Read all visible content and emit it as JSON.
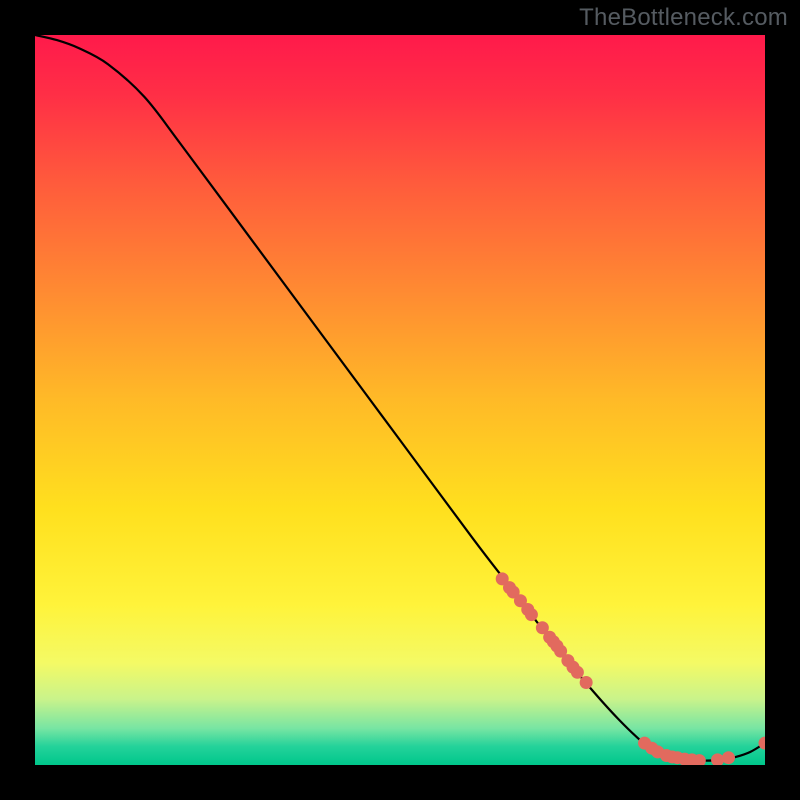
{
  "watermark": "TheBottleneck.com",
  "colors": {
    "bg_black": "#000000",
    "curve": "#000000",
    "dot_fill": "#e26a5e",
    "dot_stroke": "#c74a3e"
  },
  "chart_data": {
    "type": "line",
    "title": "",
    "xlabel": "",
    "ylabel": "",
    "xlim": [
      0,
      100
    ],
    "ylim": [
      0,
      100
    ],
    "grid": false,
    "legend": false,
    "series": [
      {
        "name": "curve",
        "x": [
          0,
          3,
          6,
          10,
          15,
          20,
          30,
          40,
          50,
          60,
          65,
          70,
          75,
          80,
          84,
          86,
          88,
          90,
          92,
          94,
          96,
          98,
          100
        ],
        "y": [
          100,
          99.3,
          98.2,
          96,
          91.5,
          85,
          71.5,
          58,
          44.5,
          31,
          24.5,
          18,
          11.8,
          6.2,
          2.5,
          1.6,
          1.0,
          0.7,
          0.6,
          0.7,
          1.1,
          1.8,
          3.0
        ]
      }
    ],
    "points": [
      {
        "name": "dot",
        "x": 64,
        "y": 25.5
      },
      {
        "name": "dot",
        "x": 65,
        "y": 24.3
      },
      {
        "name": "dot",
        "x": 65.5,
        "y": 23.7
      },
      {
        "name": "dot",
        "x": 66.5,
        "y": 22.5
      },
      {
        "name": "dot",
        "x": 67.5,
        "y": 21.3
      },
      {
        "name": "dot",
        "x": 68,
        "y": 20.6
      },
      {
        "name": "dot",
        "x": 69.5,
        "y": 18.8
      },
      {
        "name": "dot",
        "x": 70.5,
        "y": 17.5
      },
      {
        "name": "dot",
        "x": 71,
        "y": 16.9
      },
      {
        "name": "dot",
        "x": 71.5,
        "y": 16.3
      },
      {
        "name": "dot",
        "x": 72,
        "y": 15.6
      },
      {
        "name": "dot",
        "x": 73,
        "y": 14.3
      },
      {
        "name": "dot",
        "x": 73.7,
        "y": 13.4
      },
      {
        "name": "dot",
        "x": 74.3,
        "y": 12.7
      },
      {
        "name": "dot",
        "x": 75.5,
        "y": 11.3
      },
      {
        "name": "dot",
        "x": 83.5,
        "y": 3.0
      },
      {
        "name": "dot",
        "x": 84.5,
        "y": 2.3
      },
      {
        "name": "dot",
        "x": 85.3,
        "y": 1.8
      },
      {
        "name": "dot",
        "x": 86.5,
        "y": 1.3
      },
      {
        "name": "dot",
        "x": 87.3,
        "y": 1.1
      },
      {
        "name": "dot",
        "x": 88,
        "y": 1.0
      },
      {
        "name": "dot",
        "x": 89,
        "y": 0.8
      },
      {
        "name": "dot",
        "x": 90,
        "y": 0.7
      },
      {
        "name": "dot",
        "x": 91,
        "y": 0.6
      },
      {
        "name": "dot",
        "x": 93.5,
        "y": 0.7
      },
      {
        "name": "dot",
        "x": 95,
        "y": 1.0
      },
      {
        "name": "dot",
        "x": 100,
        "y": 3.0
      }
    ],
    "background_gradient_stops": [
      {
        "offset": 0.0,
        "color": "#ff1a4b"
      },
      {
        "offset": 0.08,
        "color": "#ff2e46"
      },
      {
        "offset": 0.2,
        "color": "#ff5a3c"
      },
      {
        "offset": 0.35,
        "color": "#ff8a32"
      },
      {
        "offset": 0.5,
        "color": "#ffba27"
      },
      {
        "offset": 0.65,
        "color": "#ffe01e"
      },
      {
        "offset": 0.78,
        "color": "#fff33a"
      },
      {
        "offset": 0.86,
        "color": "#f4fa65"
      },
      {
        "offset": 0.91,
        "color": "#c9f38b"
      },
      {
        "offset": 0.95,
        "color": "#77e5a3"
      },
      {
        "offset": 0.975,
        "color": "#23d29a"
      },
      {
        "offset": 1.0,
        "color": "#00c78b"
      }
    ]
  }
}
